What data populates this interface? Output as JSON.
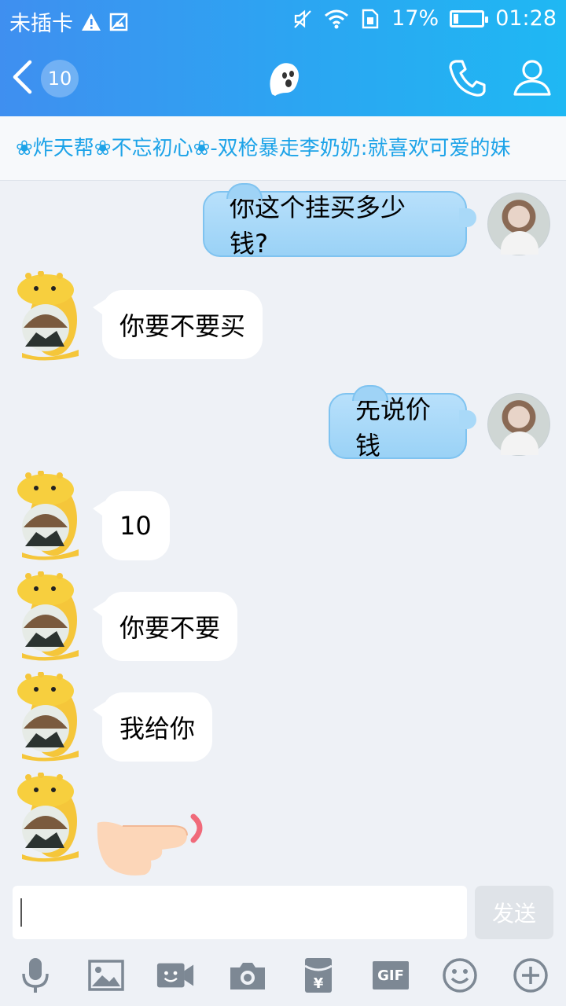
{
  "status_bar": {
    "carrier": "未插卡",
    "battery_percent": "17%",
    "battery_level": 0.17,
    "time": "01:28"
  },
  "nav": {
    "unread_count": "10",
    "icons": [
      "back-icon",
      "ghost-icon",
      "phone-icon",
      "user-icon"
    ]
  },
  "group_notice": "❀炸天帮❀不忘初心❀-双枪暴走李奶奶:就喜欢可爱的妹",
  "messages": [
    {
      "from": "me",
      "text": "你这个挂买多少钱?"
    },
    {
      "from": "other",
      "text": "你要不要买"
    },
    {
      "from": "me",
      "text": "先说价钱"
    },
    {
      "from": "other",
      "text": "10"
    },
    {
      "from": "other",
      "text": "你要不要"
    },
    {
      "from": "other",
      "text": "我给你"
    },
    {
      "from": "other",
      "sticker": "pointing-hand"
    }
  ],
  "input": {
    "value": "",
    "send_label": "发送"
  },
  "toolbar": {
    "items": [
      "mic-icon",
      "image-icon",
      "video-call-icon",
      "camera-icon",
      "red-packet-icon",
      "gif-icon",
      "emoji-icon",
      "plus-icon"
    ],
    "gif_label": "GIF",
    "red_packet_label": "¥"
  },
  "colors": {
    "header_start": "#3f8ff0",
    "header_end": "#1fb8f3",
    "notice_text": "#1da3e8",
    "my_bubble": "#9ad2f6",
    "background": "#eef1f6"
  }
}
